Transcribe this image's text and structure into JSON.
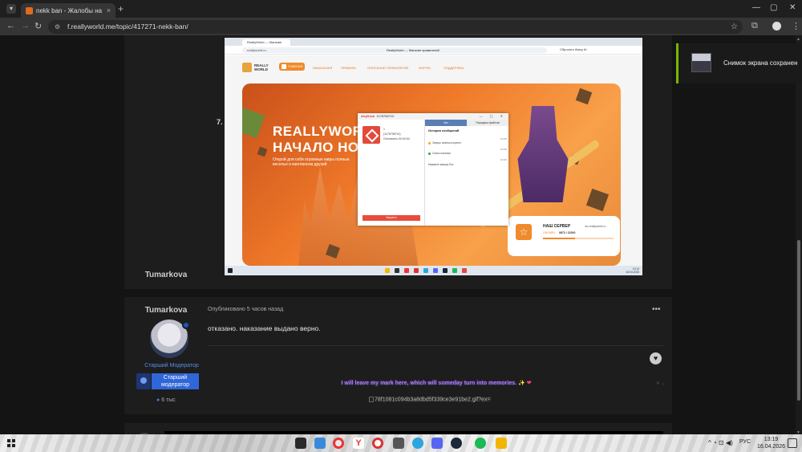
{
  "browser": {
    "tab_title": "nekk ban - Жалобы на Админ",
    "tab_close": "×",
    "new_tab": "+",
    "url": "f.reallyworld.me/topic/417271-nekk-ban/",
    "window_controls": [
      "—",
      "▢",
      "✕"
    ]
  },
  "embedded_screenshot": {
    "tab_title": "ReallyWorld — Магазин",
    "url_short": "reallyworld.ru",
    "url_center": "ReallyWorld — Магазин привилегий",
    "reset_label": "Сбросить Atacy AI",
    "logo_text": "REALLY WORLD",
    "nav": [
      "ГЛАВНАЯ",
      "НАКАЗАНИЯ",
      "ПРАВИЛА",
      "ОПИСАНИЕ ПРИВИЛЕГИЙ",
      "ФОРУМ",
      "ПОДДЕРЖКА"
    ],
    "hero_title_1": "REALLYWORL",
    "hero_title_2": "НАЧАЛО НОВ",
    "hero_sub": "Открой для себя огромные миры полные веселья и миллионов друзей",
    "server_title": "НАШ СЕРВЕР",
    "server_ip": "mc.reallyworld.ru",
    "server_online_label": "ОНЛАЙН:",
    "server_online": "9872 / 22000",
    "server_fill": 0.45,
    "clock_time": "10:14",
    "clock_date": "16.04.2026",
    "anydesk": {
      "brand": "AnyDesk",
      "id_title": "1178798710",
      "window_controls": "— ▢ ✕",
      "remote_line1": "1",
      "remote_line2": "(1178798710)",
      "remote_line3": "Отключено 00:00:54",
      "decline": "Закрыть",
      "tab_chat": "Чат",
      "tab_files": "Передача файлов",
      "history_title": "История сообщений",
      "events": [
        {
          "text": "Запрос сеанса получен",
          "time": "10:08",
          "color": "#f0b030"
        },
        {
          "text": "Сеанс начался",
          "time": "10:08",
          "color": "#3cb043"
        },
        {
          "text": "Нажмите мышку Esc",
          "time": "10:09",
          "color": ""
        }
      ]
    }
  },
  "post_index": "7.",
  "post": {
    "author": "Tumarkova",
    "rank": "Старший Модератор",
    "group": "Старший модератор",
    "reputation": "6 тыс",
    "published": "Опубликовано 5 часов назад",
    "menu": "•••",
    "body": "отказано. наказание выдано верно.",
    "signature": "I will leave my mark here, which will someday turn into memories.",
    "signature_emoji": "✨ ❤",
    "signature_close": "✕ ⌄",
    "gif_alt": "78f1081c094b3a8dbd5f339ce3e91be2.gif?ex="
  },
  "toast": {
    "text": "Снимок экрана сохранен"
  },
  "taskbar": {
    "lang": "РУС",
    "time": "13:19",
    "date": "16.04.2026",
    "tray": "^ ◔ ⊡ ◀)"
  },
  "colors": {
    "accent_orange": "#f08a2b",
    "signature_purple": "#a67de8",
    "group_blue": "#2f66d8",
    "toast_green": "#76b900"
  }
}
